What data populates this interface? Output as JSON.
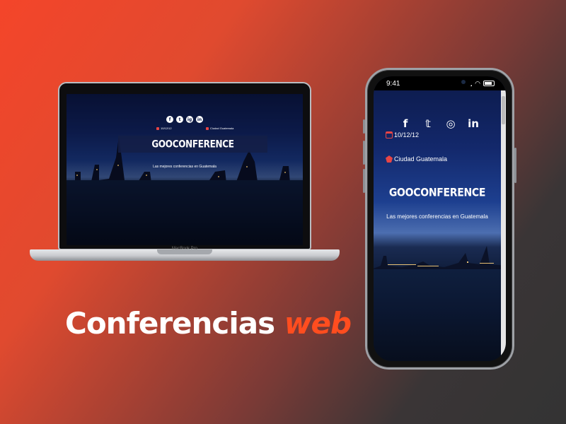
{
  "laptop": {
    "brand": "MacBook Pro",
    "site": {
      "social": [
        "f",
        "t",
        "ig",
        "in"
      ],
      "date": "10/12/12",
      "city": "Ciudad Guatemala",
      "title": "GOOCONFERENCE",
      "tagline": "Las mejores conferencias en Guatemala"
    }
  },
  "phone": {
    "status": {
      "time": "9:41"
    },
    "site": {
      "social": [
        "f",
        "𝕥",
        "◎",
        "in"
      ],
      "date": "10/12/12",
      "city": "Ciudad Guatemala",
      "title": "GOOCONFERENCE",
      "tagline": "Las mejores conferencias en Guatemala"
    }
  },
  "headline": {
    "main": "Conferencias",
    "accent": "web"
  },
  "colors": {
    "accent": "#ff4d1f",
    "icon_red": "#e84545",
    "bg_start": "#f4452a",
    "bg_end": "#333333"
  },
  "icons": [
    "facebook-icon",
    "twitter-icon",
    "instagram-icon",
    "linkedin-icon",
    "calendar-icon",
    "location-icon"
  ]
}
